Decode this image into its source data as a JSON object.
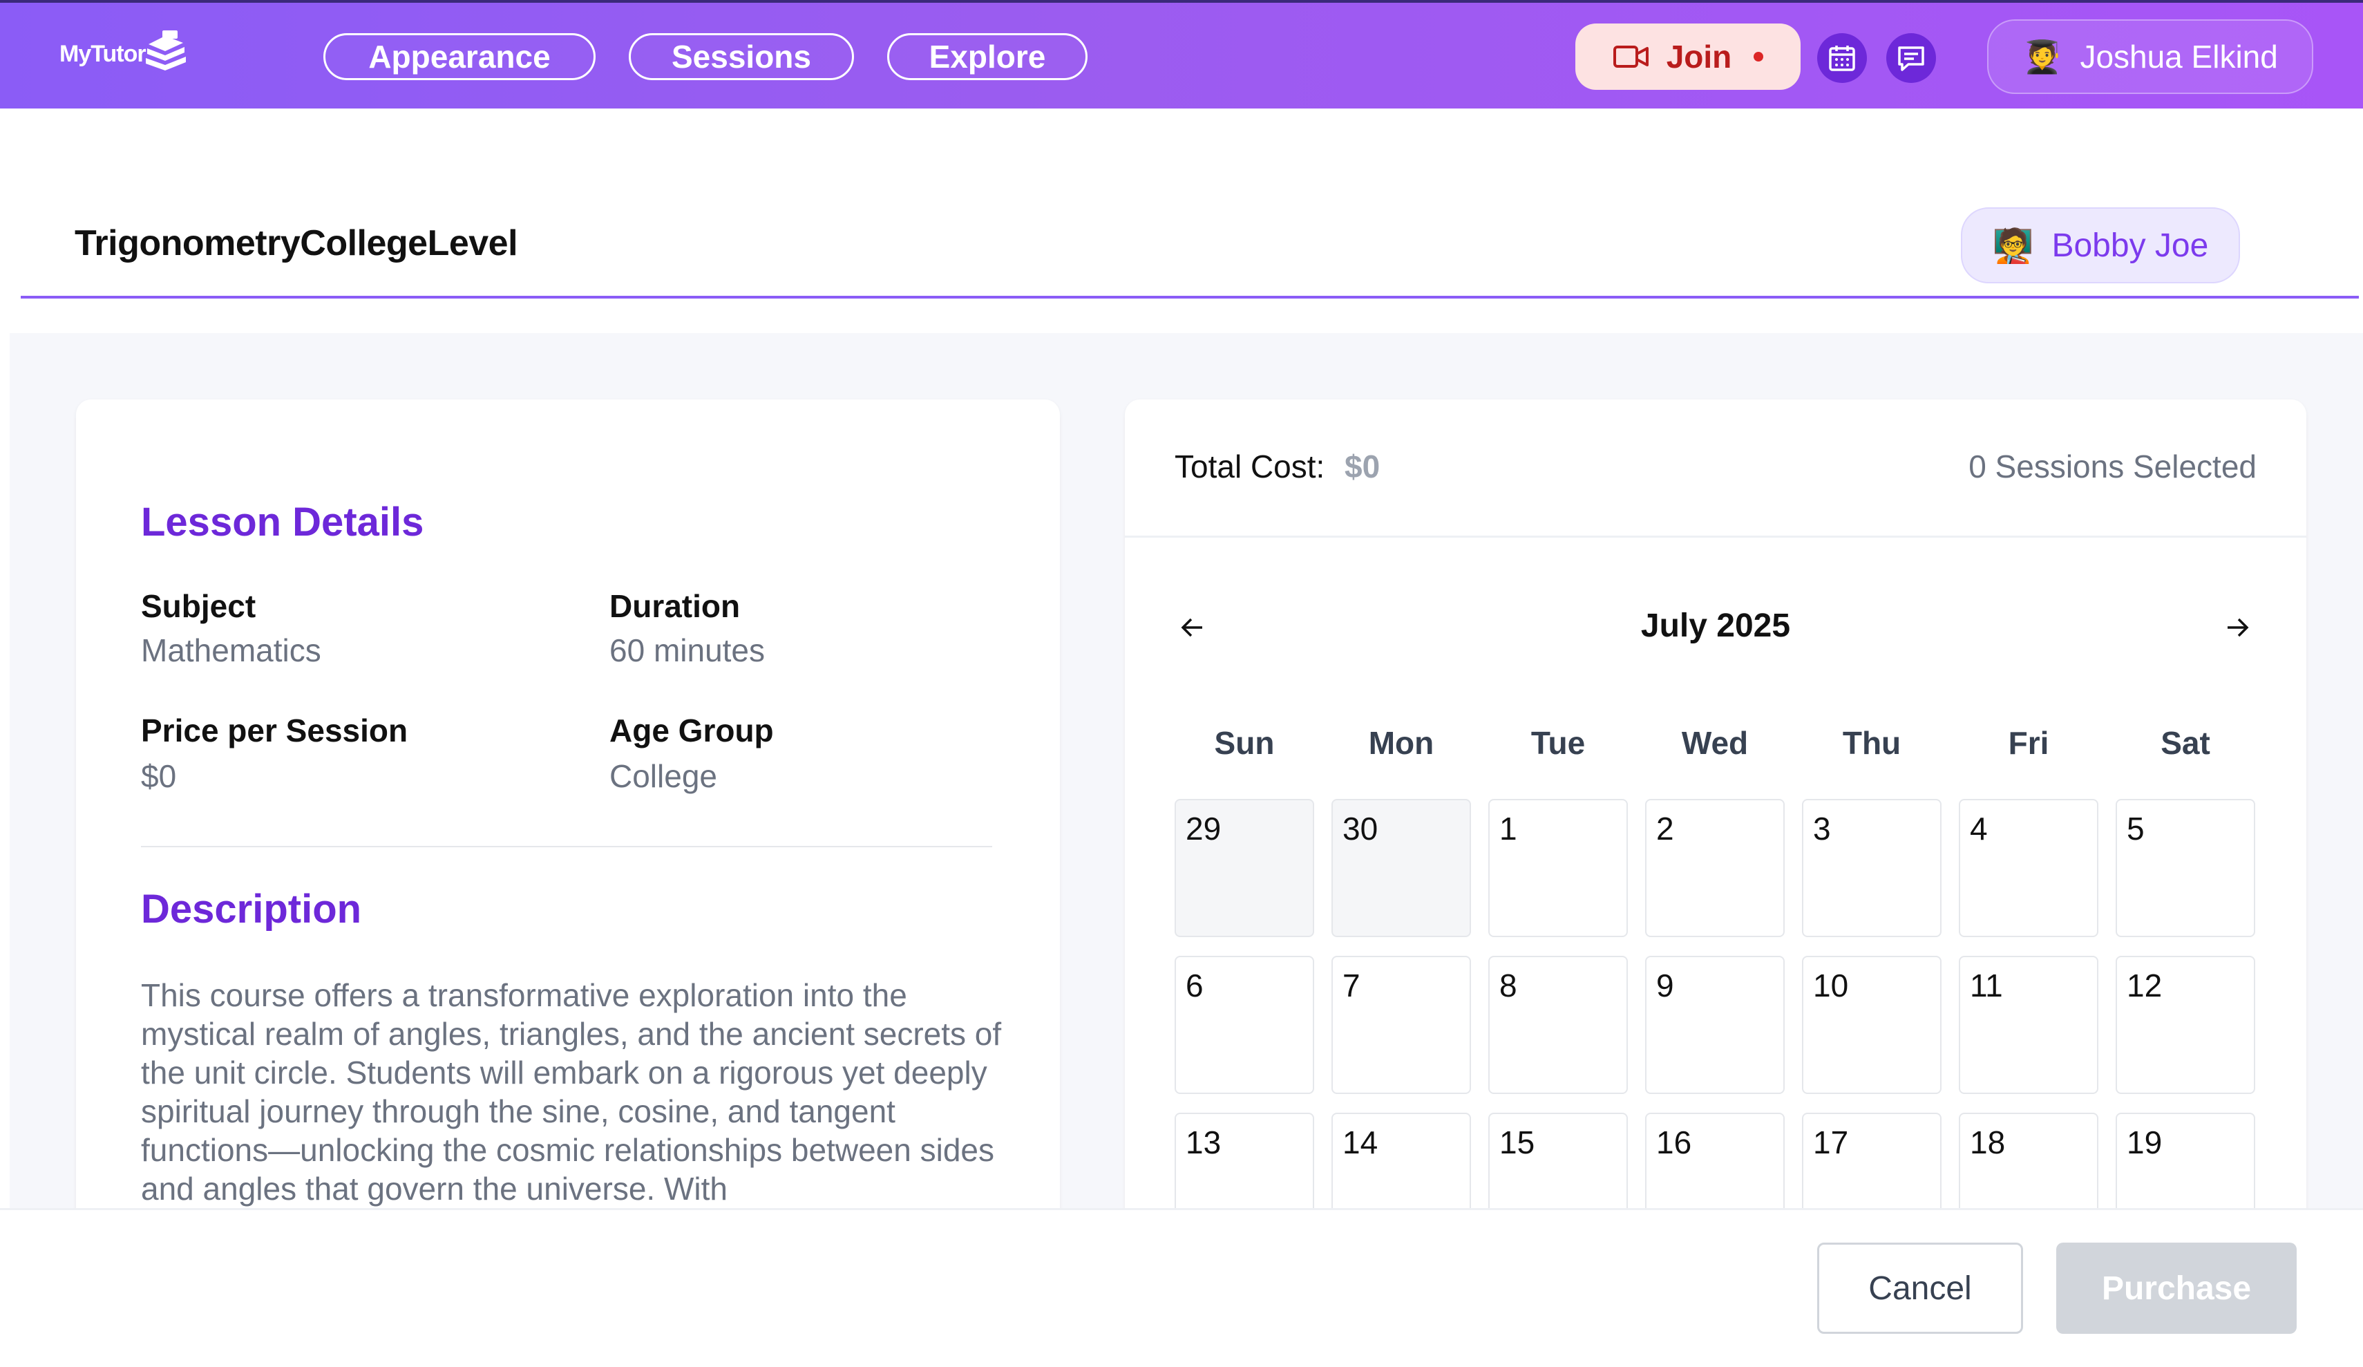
{
  "app": {
    "logo_text": "MyTutor",
    "nav": [
      "Appearance",
      "Sessions",
      "Explore"
    ],
    "join_label": "Join",
    "icons": [
      "calendar-icon",
      "chat-icon",
      "video-camera-icon"
    ],
    "user": {
      "name": "Joshua Elkind",
      "avatar": "🧑‍🎓"
    }
  },
  "header": {
    "title": "TrigonometryCollegeLevel",
    "tutor": {
      "name": "Bobby Joe",
      "avatar": "🧑‍🏫"
    }
  },
  "lesson": {
    "section_title": "Lesson Details",
    "fields": [
      {
        "label": "Subject",
        "value": "Mathematics"
      },
      {
        "label": "Duration",
        "value": "60 minutes"
      },
      {
        "label": "Price per Session",
        "value": "$0"
      },
      {
        "label": "Age Group",
        "value": "College"
      }
    ],
    "description_title": "Description",
    "description": "This course offers a transformative exploration into the mystical realm of angles, triangles, and the ancient secrets of the unit circle. Students will embark on a rigorous yet deeply spiritual journey through the sine, cosine, and tangent functions—unlocking the cosmic relationships between sides and angles that govern the universe. With"
  },
  "booking": {
    "total_cost_label": "Total Cost:",
    "total_cost_value": "$0",
    "sessions_selected": "0 Sessions Selected",
    "month": "July 2025",
    "weekdays": [
      "Sun",
      "Mon",
      "Tue",
      "Wed",
      "Thu",
      "Fri",
      "Sat"
    ],
    "days": [
      [
        "29",
        "30",
        "1",
        "2",
        "3",
        "4",
        "5"
      ],
      [
        "6",
        "7",
        "8",
        "9",
        "10",
        "11",
        "12"
      ],
      [
        "13",
        "14",
        "15",
        "16",
        "17",
        "18",
        "19"
      ]
    ],
    "muted_days": [
      "29",
      "30"
    ]
  },
  "footer": {
    "cancel_label": "Cancel",
    "purchase_label": "Purchase"
  },
  "colors": {
    "accent": "#6d28d9",
    "topbar_start": "#8b5cf6",
    "topbar_end": "#a855f7",
    "join_bg": "#fde2e2",
    "join_text": "#b91c1c"
  }
}
